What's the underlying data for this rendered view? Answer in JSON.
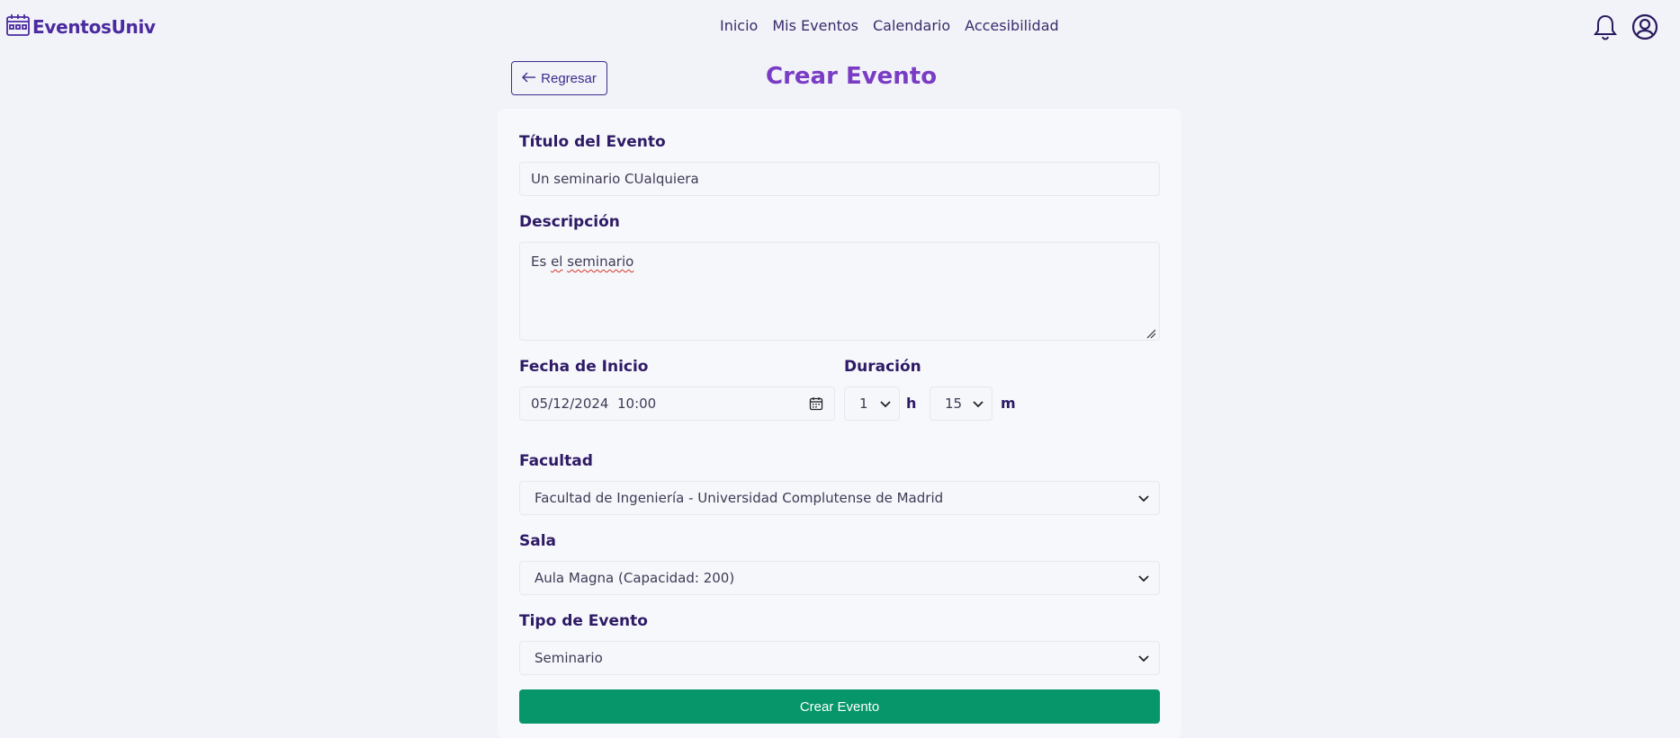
{
  "brand": {
    "name": "EventosUniv"
  },
  "nav": {
    "items": [
      "Inicio",
      "Mis Eventos",
      "Calendario",
      "Accesibilidad"
    ]
  },
  "icons": {
    "brand": "calendar-logo-icon",
    "notifications": "bell-icon",
    "profile": "user-circle-icon",
    "back": "arrow-left-icon",
    "calendar_picker": "calendar-icon",
    "dropdown": "chevron-down-icon"
  },
  "page": {
    "back_label": "Regresar",
    "title": "Crear Evento"
  },
  "form": {
    "title_label": "Título del Evento",
    "title_value": "Un seminario CUalquiera",
    "description_label": "Descripción",
    "description_value": {
      "part1": "Es ",
      "part2": "el",
      "part3": " ",
      "part4": "seminario"
    },
    "start_label": "Fecha de Inicio",
    "start_value": "05/12/2024  10:00",
    "duration_label": "Duración",
    "duration_hours": "1",
    "hours_unit": "h",
    "duration_minutes": "15",
    "minutes_unit": "m",
    "faculty_label": "Facultad",
    "faculty_value": "Facultad de Ingeniería - Universidad Complutense de Madrid",
    "room_label": "Sala",
    "room_value": "Aula Magna (Capacidad: 200)",
    "type_label": "Tipo de Evento",
    "type_value": "Seminario",
    "submit_label": "Crear Evento"
  },
  "colors": {
    "background": "#f1f3f9",
    "brand": "#4b2aa0",
    "title": "#7a3cc4",
    "submit": "#069669"
  }
}
